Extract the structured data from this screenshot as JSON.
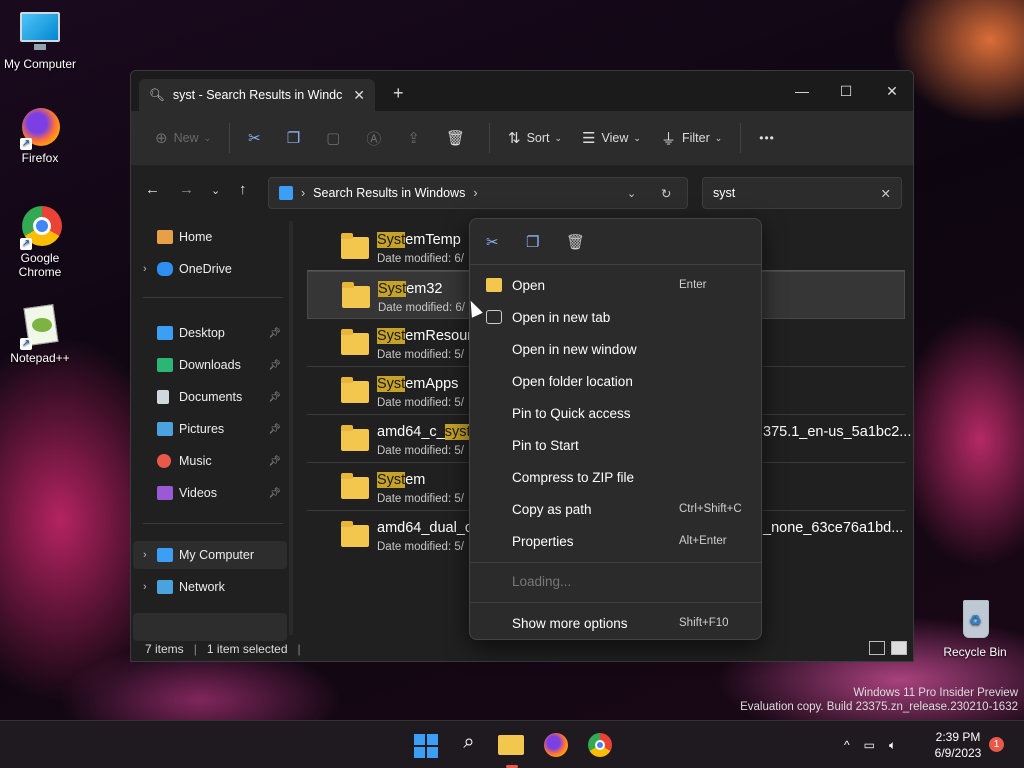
{
  "desktop": {
    "icons": [
      {
        "label": "My Computer"
      },
      {
        "label": "Firefox"
      },
      {
        "label": "Google Chrome"
      },
      {
        "label": "Notepad++"
      },
      {
        "label": "Recycle Bin"
      }
    ]
  },
  "window": {
    "tab_title": "syst - Search Results in Windc",
    "tab_close": "✕",
    "new_tab": "+",
    "controls": {
      "minimize": "—",
      "maximize": "☐",
      "close": "✕"
    }
  },
  "toolbar": {
    "new_label": "New",
    "sort_label": "Sort",
    "view_label": "View",
    "filter_label": "Filter",
    "more_label": "•••"
  },
  "address": {
    "path": "Search Results in Windows",
    "search_value": "syst"
  },
  "sidebar": {
    "items": [
      {
        "label": "Home"
      },
      {
        "label": "OneDrive"
      },
      {
        "label": "Desktop"
      },
      {
        "label": "Downloads"
      },
      {
        "label": "Documents"
      },
      {
        "label": "Pictures"
      },
      {
        "label": "Music"
      },
      {
        "label": "Videos"
      },
      {
        "label": "My Computer"
      },
      {
        "label": "Network"
      }
    ]
  },
  "files": [
    {
      "hl": "Syst",
      "rest": "emTemp",
      "pre": "",
      "meta": "Date modified: 6/",
      "tail": ""
    },
    {
      "hl": "Syst",
      "rest": "em32",
      "pre": "",
      "meta": "Date modified: 6/",
      "tail": ""
    },
    {
      "hl": "Syst",
      "rest": "emResour",
      "pre": "",
      "meta": "Date modified: 5/",
      "tail": ""
    },
    {
      "hl": "Syst",
      "rest": "emApps",
      "pre": "",
      "meta": "Date modified: 5/",
      "tail": ""
    },
    {
      "hl": "syste",
      "rest": "",
      "pre": "amd64_c_",
      "meta": "Date modified: 5/",
      "tail": "375.1_en-us_5a1bc2..."
    },
    {
      "hl": "Syst",
      "rest": "em",
      "pre": "",
      "meta": "Date modified: 5/",
      "tail": ""
    },
    {
      "hl": "",
      "rest": "",
      "pre": "amd64_dual_c",
      "meta": "Date modified: 5/",
      "tail": "_none_63ce76a1bd..."
    }
  ],
  "status": {
    "count": "7 items",
    "selected": "1 item selected"
  },
  "context_menu": {
    "items": [
      {
        "label": "Open",
        "shortcut": "Enter"
      },
      {
        "label": "Open in new tab",
        "shortcut": ""
      },
      {
        "label": "Open in new window",
        "shortcut": ""
      },
      {
        "label": "Open folder location",
        "shortcut": ""
      },
      {
        "label": "Pin to Quick access",
        "shortcut": ""
      },
      {
        "label": "Pin to Start",
        "shortcut": ""
      },
      {
        "label": "Compress to ZIP file",
        "shortcut": ""
      },
      {
        "label": "Copy as path",
        "shortcut": "Ctrl+Shift+C"
      },
      {
        "label": "Properties",
        "shortcut": "Alt+Enter"
      }
    ],
    "loading": "Loading...",
    "more": {
      "label": "Show more options",
      "shortcut": "Shift+F10"
    }
  },
  "watermark": {
    "line1": "Windows 11 Pro Insider Preview",
    "line2": "Evaluation copy. Build 23375.zn_release.230210-1632"
  },
  "taskbar": {
    "time": "2:39 PM",
    "date": "6/9/2023",
    "notifications": "1"
  },
  "colors": {
    "highlight": "#c7a228",
    "folder": "#f3c74d",
    "accent": "#3b9ff5"
  }
}
